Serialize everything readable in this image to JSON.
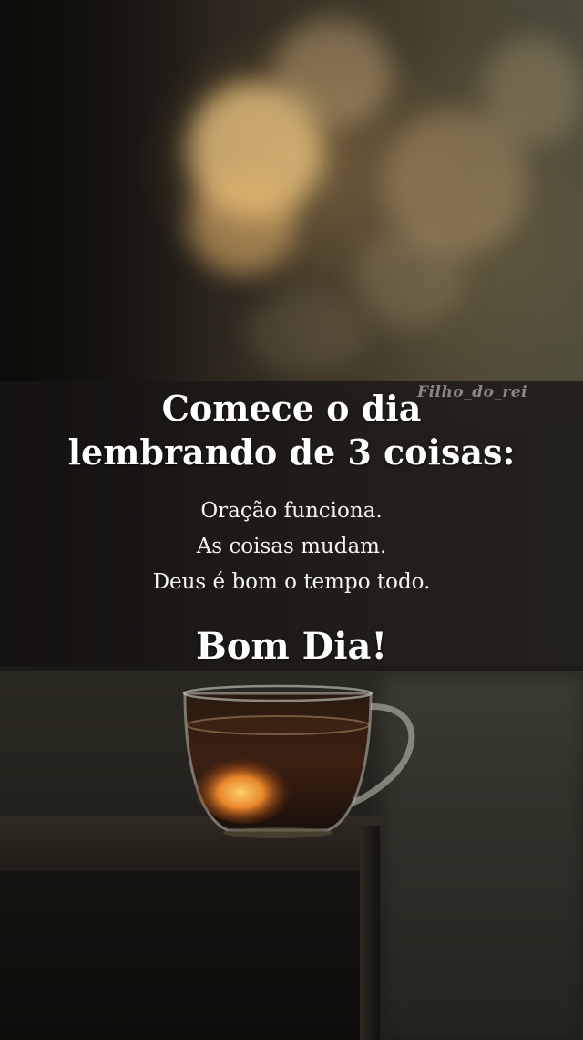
{
  "watermark": "Filho_do_rei",
  "headline": {
    "line1": "Comece o dia",
    "line2": "lembrando de 3 coisas:"
  },
  "items": [
    "Oração funciona.",
    "As coisas mudam.",
    "Deus é bom o tempo todo."
  ],
  "greeting": "Bom Dia!"
}
